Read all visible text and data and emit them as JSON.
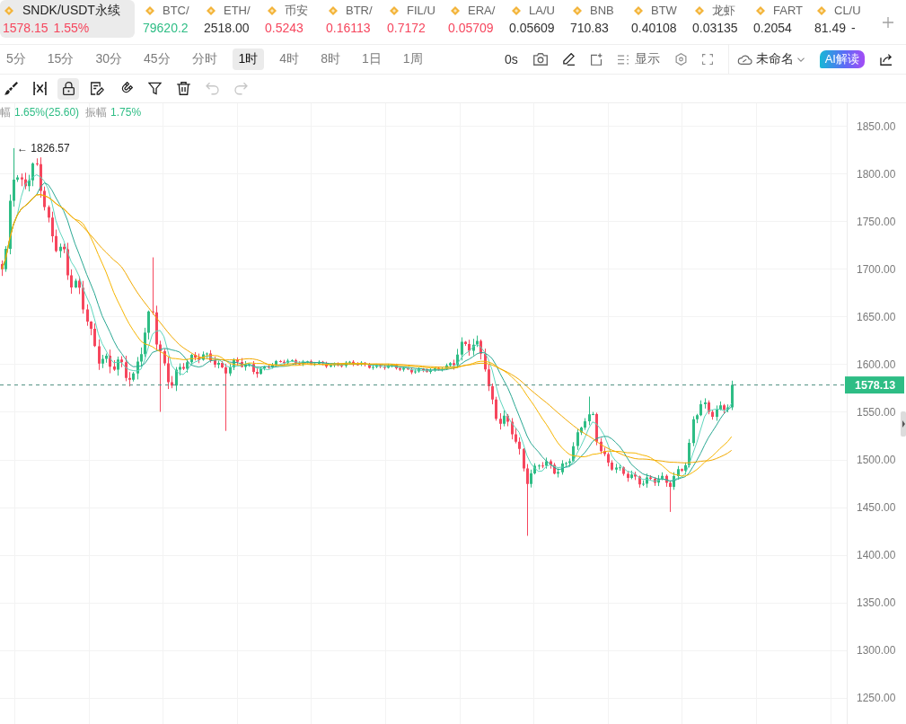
{
  "tickers": [
    {
      "name": "SNDK/USDT永续",
      "price": "1578.15",
      "change": "1.55%",
      "color": "#f6465d",
      "selected": true
    },
    {
      "name": "BTC/",
      "price": "79620.2",
      "color": "#2ebd85",
      "selected": false
    },
    {
      "name": "ETH/",
      "price": "2518.00",
      "color": "#333333",
      "selected": false
    },
    {
      "name": "币安",
      "price": "0.5243",
      "color": "#f6465d",
      "selected": false
    },
    {
      "name": "BTR/",
      "price": "0.16113",
      "color": "#f6465d",
      "selected": false
    },
    {
      "name": "FIL/U",
      "price": "0.7172",
      "color": "#f6465d",
      "selected": false
    },
    {
      "name": "ERA/",
      "price": "0.05709",
      "color": "#f6465d",
      "selected": false
    },
    {
      "name": "LA/U",
      "price": "0.05609",
      "color": "#333333",
      "selected": false
    },
    {
      "name": "BNB",
      "price": "710.83",
      "color": "#333333",
      "selected": false
    },
    {
      "name": "BTW",
      "price": "0.40108",
      "color": "#333333",
      "selected": false
    },
    {
      "name": "龙虾",
      "price": "0.03135",
      "color": "#333333",
      "selected": false
    },
    {
      "name": "FART",
      "price": "0.2054",
      "color": "#333333",
      "selected": false
    },
    {
      "name": "CL/U",
      "price": "81.49",
      "change": "-",
      "color": "#333333",
      "selected": false
    }
  ],
  "intervals": [
    {
      "label": "5分",
      "selected": false
    },
    {
      "label": "15分",
      "selected": false
    },
    {
      "label": "30分",
      "selected": false
    },
    {
      "label": "45分",
      "selected": false
    },
    {
      "label": "分时",
      "selected": false
    },
    {
      "label": "1时",
      "selected": true
    },
    {
      "label": "4时",
      "selected": false
    },
    {
      "label": "8时",
      "selected": false
    },
    {
      "label": "1日",
      "selected": false
    },
    {
      "label": "1周",
      "selected": false
    }
  ],
  "chart_toolbar": {
    "countdown": "0s",
    "display_label": "显示",
    "layout_name": "未命名",
    "ai_label": "AI解读"
  },
  "drawing_tools": [
    {
      "kind": "brush",
      "on": false,
      "disabled": false
    },
    {
      "kind": "bars",
      "on": false,
      "disabled": false
    },
    {
      "kind": "lock",
      "on": true,
      "disabled": false
    },
    {
      "kind": "note",
      "on": false,
      "disabled": false
    },
    {
      "kind": "magnet",
      "on": false,
      "disabled": false
    },
    {
      "kind": "filter",
      "on": false,
      "disabled": false
    },
    {
      "kind": "trash",
      "on": false,
      "disabled": false
    },
    {
      "kind": "undo",
      "on": false,
      "disabled": true
    },
    {
      "kind": "redo",
      "on": false,
      "disabled": true
    }
  ],
  "stats": [
    {
      "label": "幅",
      "value": "1.65%(25.60)"
    },
    {
      "label": "振幅",
      "value": "1.75%"
    }
  ],
  "chart": {
    "high_marker": "← 1826.57",
    "last_price": "1578.13",
    "price_labels": [
      "1850.00",
      "1800.00",
      "1750.00",
      "1700.00",
      "1650.00",
      "1600.00",
      "1550.00",
      "1500.00",
      "1450.00",
      "1400.00",
      "1350.00",
      "1300.00",
      "1250.00"
    ]
  }
}
